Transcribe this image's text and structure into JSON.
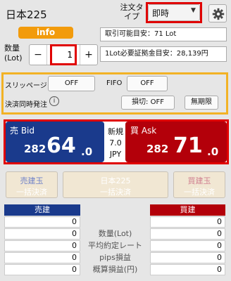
{
  "header": {
    "title": "日本225",
    "order_type_label": "注文タイプ",
    "order_type_value": "即時"
  },
  "info_button": "info",
  "quantity": {
    "label": "数量(Lot)",
    "minus": "−",
    "plus": "+",
    "value": "1"
  },
  "summary": {
    "available": "取引可能目安：71 Lot",
    "margin_per_lot": "1Lot必要証拠金目安：28,139円"
  },
  "options": {
    "slippage_label": "スリッページ",
    "slippage_value": "OFF",
    "fifo_label": "FIFO",
    "fifo_value": "OFF",
    "settle_label": "決済同時発注",
    "info_icon": "i",
    "settle_value": "損切: OFF",
    "limit_value": "無期限"
  },
  "prices": {
    "bid_label": "売 Bid",
    "bid_prefix": "282",
    "bid_main": "64",
    "bid_decimal": ".0",
    "ask_label": "買 Ask",
    "ask_prefix": "282",
    "ask_main": "71",
    "ask_decimal": ".0",
    "spread_label": "新規",
    "spread_value": "7.0",
    "spread_unit": "JPY"
  },
  "bulk": {
    "sell_line1": "売建玉",
    "sell_line2": "一括決済",
    "all_line1": "日本225",
    "all_line2": "一括決済",
    "buy_line1": "買建玉",
    "buy_line2": "一括決済"
  },
  "positions": {
    "sell_header": "売建",
    "buy_header": "買建",
    "rows": [
      {
        "label": "",
        "sell": "0",
        "buy": "0"
      },
      {
        "label": "数量(Lot)",
        "sell": "0",
        "buy": "0"
      },
      {
        "label": "平均約定レート",
        "sell": "0",
        "buy": "0"
      },
      {
        "label": "pips損益",
        "sell": "0",
        "buy": "0"
      },
      {
        "label": "概算損益(円)",
        "sell": "0",
        "buy": "0"
      }
    ]
  },
  "colors": {
    "bid": "#1a3a8c",
    "ask": "#b3000a",
    "highlight_red": "#e00000",
    "highlight_orange": "#f2b225",
    "info_orange": "#f29b0c"
  }
}
